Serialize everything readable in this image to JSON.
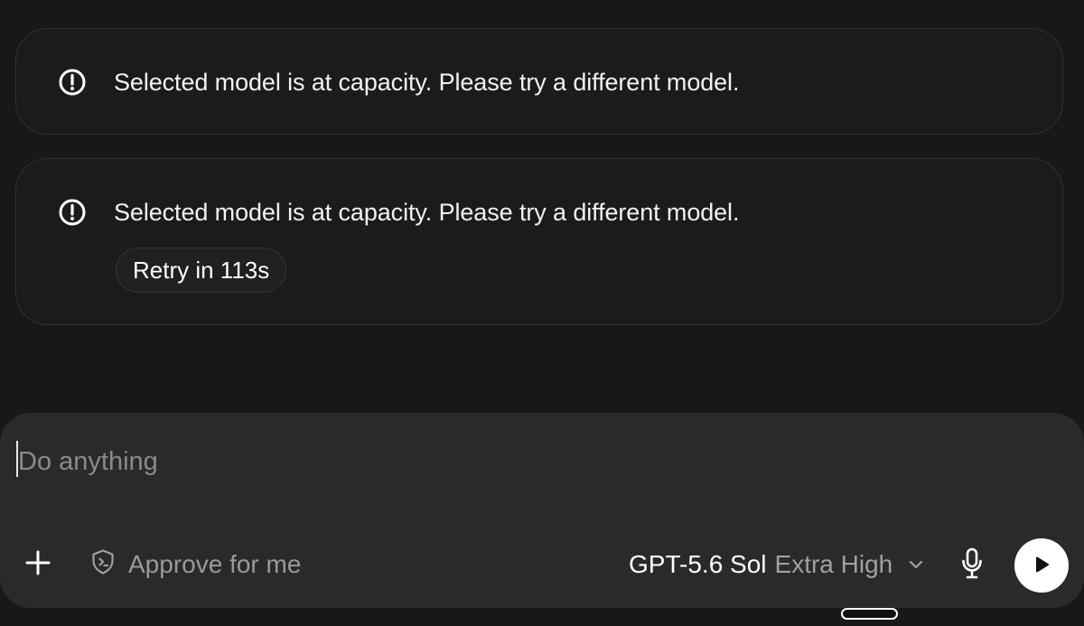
{
  "notices": [
    {
      "icon": "exclamation-circle-icon",
      "message": "Selected model is at capacity. Please try a different model."
    },
    {
      "icon": "exclamation-circle-icon",
      "message": "Selected model is at capacity. Please try a different model.",
      "retry_label": "Retry in 113s"
    }
  ],
  "composer": {
    "placeholder": "Do anything",
    "value": "",
    "add_icon": "plus-icon",
    "approval": {
      "icon": "shield-terminal-icon",
      "label": "Approve for me"
    },
    "model": {
      "name": "GPT-5.6 Sol",
      "reasoning_level": "Extra High",
      "chevron_icon": "chevron-down-icon"
    },
    "mic_icon": "microphone-icon",
    "send_icon": "play-send-icon"
  },
  "colors": {
    "background": "#181818",
    "composer": "#2a2a2a",
    "text": "#f2f2f2",
    "muted": "#9a9a9a",
    "send_button": "#ffffff"
  }
}
